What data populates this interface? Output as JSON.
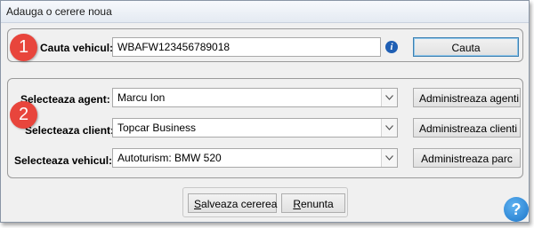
{
  "window": {
    "title": "Adauga o cerere noua"
  },
  "badges": {
    "one": "1",
    "two": "2"
  },
  "search": {
    "label": "Cauta vehicul:",
    "value": "WBAFW123456789018",
    "info_icon": "info-icon",
    "button_label": "Cauta"
  },
  "selects": {
    "agent": {
      "label": "Selecteaza agent:",
      "value": "Marcu Ion",
      "button_label": "Administreaza agenti"
    },
    "client": {
      "label": "Selecteaza client:",
      "value": "Topcar Business",
      "button_label": "Administreaza clienti"
    },
    "vehicle": {
      "label": "Selecteaza vehicul:",
      "value": "Autoturism: BMW 520",
      "button_label": "Administreaza parc"
    }
  },
  "footer": {
    "save_first": "S",
    "save_rest": "alveaza cererea",
    "cancel_first": "R",
    "cancel_rest": "enunta"
  },
  "help": {
    "icon": "help-icon",
    "glyph": "?"
  },
  "colors": {
    "badge": "#e8453c",
    "info": "#1f5fb4",
    "help": "#1b74c8"
  }
}
